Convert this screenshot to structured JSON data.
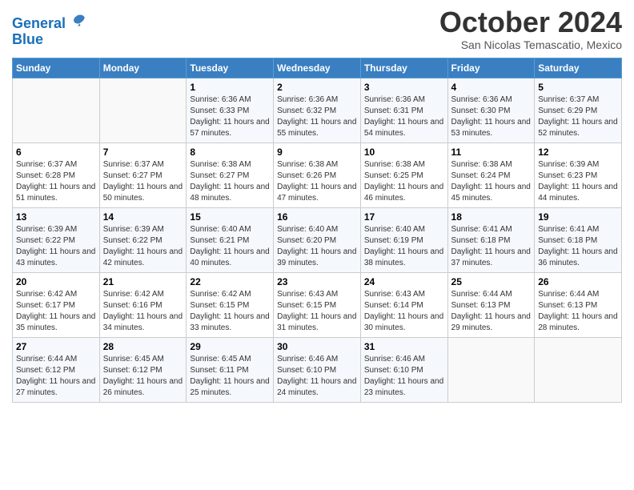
{
  "header": {
    "logo_line1": "General",
    "logo_line2": "Blue",
    "month": "October 2024",
    "location": "San Nicolas Temascatio, Mexico"
  },
  "days_of_week": [
    "Sunday",
    "Monday",
    "Tuesday",
    "Wednesday",
    "Thursday",
    "Friday",
    "Saturday"
  ],
  "weeks": [
    [
      {
        "day": "",
        "info": ""
      },
      {
        "day": "",
        "info": ""
      },
      {
        "day": "1",
        "info": "Sunrise: 6:36 AM\nSunset: 6:33 PM\nDaylight: 11 hours and 57 minutes."
      },
      {
        "day": "2",
        "info": "Sunrise: 6:36 AM\nSunset: 6:32 PM\nDaylight: 11 hours and 55 minutes."
      },
      {
        "day": "3",
        "info": "Sunrise: 6:36 AM\nSunset: 6:31 PM\nDaylight: 11 hours and 54 minutes."
      },
      {
        "day": "4",
        "info": "Sunrise: 6:36 AM\nSunset: 6:30 PM\nDaylight: 11 hours and 53 minutes."
      },
      {
        "day": "5",
        "info": "Sunrise: 6:37 AM\nSunset: 6:29 PM\nDaylight: 11 hours and 52 minutes."
      }
    ],
    [
      {
        "day": "6",
        "info": "Sunrise: 6:37 AM\nSunset: 6:28 PM\nDaylight: 11 hours and 51 minutes."
      },
      {
        "day": "7",
        "info": "Sunrise: 6:37 AM\nSunset: 6:27 PM\nDaylight: 11 hours and 50 minutes."
      },
      {
        "day": "8",
        "info": "Sunrise: 6:38 AM\nSunset: 6:27 PM\nDaylight: 11 hours and 48 minutes."
      },
      {
        "day": "9",
        "info": "Sunrise: 6:38 AM\nSunset: 6:26 PM\nDaylight: 11 hours and 47 minutes."
      },
      {
        "day": "10",
        "info": "Sunrise: 6:38 AM\nSunset: 6:25 PM\nDaylight: 11 hours and 46 minutes."
      },
      {
        "day": "11",
        "info": "Sunrise: 6:38 AM\nSunset: 6:24 PM\nDaylight: 11 hours and 45 minutes."
      },
      {
        "day": "12",
        "info": "Sunrise: 6:39 AM\nSunset: 6:23 PM\nDaylight: 11 hours and 44 minutes."
      }
    ],
    [
      {
        "day": "13",
        "info": "Sunrise: 6:39 AM\nSunset: 6:22 PM\nDaylight: 11 hours and 43 minutes."
      },
      {
        "day": "14",
        "info": "Sunrise: 6:39 AM\nSunset: 6:22 PM\nDaylight: 11 hours and 42 minutes."
      },
      {
        "day": "15",
        "info": "Sunrise: 6:40 AM\nSunset: 6:21 PM\nDaylight: 11 hours and 40 minutes."
      },
      {
        "day": "16",
        "info": "Sunrise: 6:40 AM\nSunset: 6:20 PM\nDaylight: 11 hours and 39 minutes."
      },
      {
        "day": "17",
        "info": "Sunrise: 6:40 AM\nSunset: 6:19 PM\nDaylight: 11 hours and 38 minutes."
      },
      {
        "day": "18",
        "info": "Sunrise: 6:41 AM\nSunset: 6:18 PM\nDaylight: 11 hours and 37 minutes."
      },
      {
        "day": "19",
        "info": "Sunrise: 6:41 AM\nSunset: 6:18 PM\nDaylight: 11 hours and 36 minutes."
      }
    ],
    [
      {
        "day": "20",
        "info": "Sunrise: 6:42 AM\nSunset: 6:17 PM\nDaylight: 11 hours and 35 minutes."
      },
      {
        "day": "21",
        "info": "Sunrise: 6:42 AM\nSunset: 6:16 PM\nDaylight: 11 hours and 34 minutes."
      },
      {
        "day": "22",
        "info": "Sunrise: 6:42 AM\nSunset: 6:15 PM\nDaylight: 11 hours and 33 minutes."
      },
      {
        "day": "23",
        "info": "Sunrise: 6:43 AM\nSunset: 6:15 PM\nDaylight: 11 hours and 31 minutes."
      },
      {
        "day": "24",
        "info": "Sunrise: 6:43 AM\nSunset: 6:14 PM\nDaylight: 11 hours and 30 minutes."
      },
      {
        "day": "25",
        "info": "Sunrise: 6:44 AM\nSunset: 6:13 PM\nDaylight: 11 hours and 29 minutes."
      },
      {
        "day": "26",
        "info": "Sunrise: 6:44 AM\nSunset: 6:13 PM\nDaylight: 11 hours and 28 minutes."
      }
    ],
    [
      {
        "day": "27",
        "info": "Sunrise: 6:44 AM\nSunset: 6:12 PM\nDaylight: 11 hours and 27 minutes."
      },
      {
        "day": "28",
        "info": "Sunrise: 6:45 AM\nSunset: 6:12 PM\nDaylight: 11 hours and 26 minutes."
      },
      {
        "day": "29",
        "info": "Sunrise: 6:45 AM\nSunset: 6:11 PM\nDaylight: 11 hours and 25 minutes."
      },
      {
        "day": "30",
        "info": "Sunrise: 6:46 AM\nSunset: 6:10 PM\nDaylight: 11 hours and 24 minutes."
      },
      {
        "day": "31",
        "info": "Sunrise: 6:46 AM\nSunset: 6:10 PM\nDaylight: 11 hours and 23 minutes."
      },
      {
        "day": "",
        "info": ""
      },
      {
        "day": "",
        "info": ""
      }
    ]
  ]
}
